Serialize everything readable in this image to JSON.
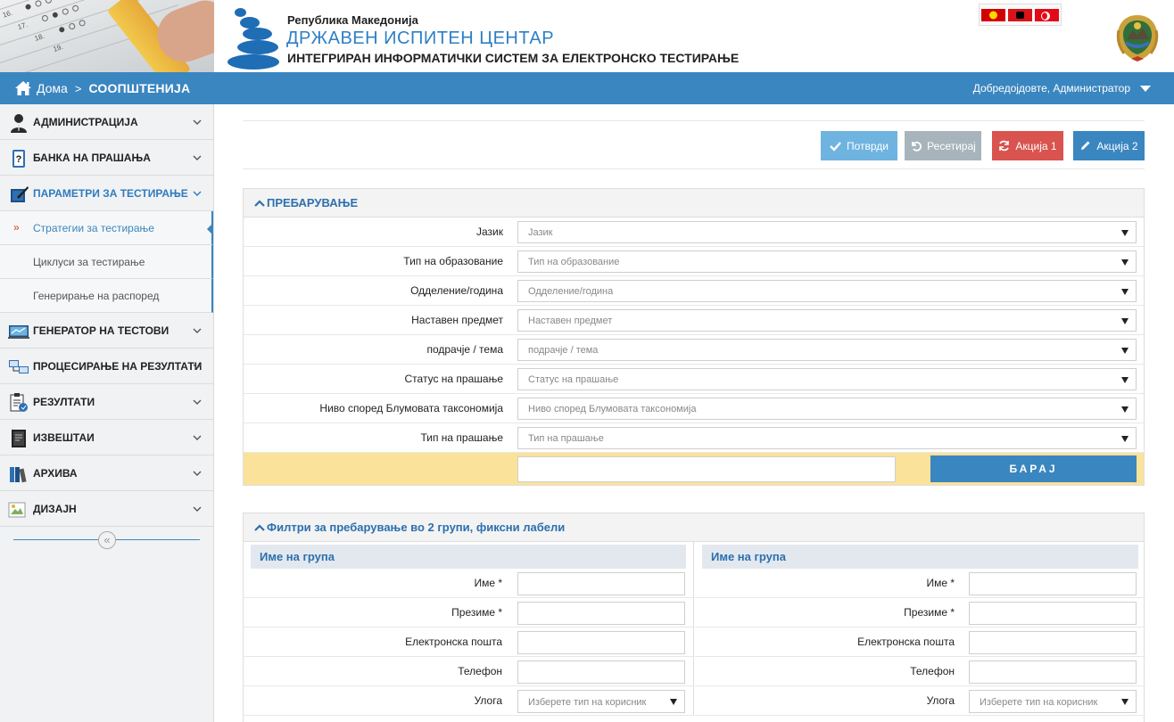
{
  "header": {
    "republic": "Република Македонија",
    "org_name": "ДРЖАВЕН ИСПИТЕН ЦЕНТАР",
    "system_name": "ИНТЕГРИРАН ИНФОРМАТИЧКИ СИСТЕМ ЗА ЕЛЕКТРОНСКО ТЕСТИРАЊЕ",
    "photo_sheet_text": [
      "16.",
      "17.",
      "18.",
      "19."
    ],
    "languages": [
      "mk",
      "sq",
      "tr"
    ]
  },
  "topbar": {
    "home_label": "Дома",
    "current_page": "СООПШТЕНИЈА",
    "welcome": "Добредојдовте, Администратор"
  },
  "sidebar": {
    "items": [
      {
        "label": "АДМИНИСТРАЦИЈА",
        "icon": "user-admin-icon"
      },
      {
        "label": "БАНКА НА ПРАШАЊА",
        "icon": "question-bank-icon"
      },
      {
        "label": "ПАРАМЕТРИ ЗА ТЕСТИРАЊЕ",
        "icon": "test-parameters-icon",
        "active": true
      },
      {
        "label": "ГЕНЕРАТОР НА ТЕСТОВИ",
        "icon": "test-generator-icon"
      },
      {
        "label": "ПРОЦЕСИРАЊЕ НА РЕЗУЛТАТИ",
        "icon": "result-processing-icon"
      },
      {
        "label": "РЕЗУЛТАТИ",
        "icon": "results-icon"
      },
      {
        "label": "ИЗВЕШТАИ",
        "icon": "reports-icon"
      },
      {
        "label": "АРХИВА",
        "icon": "archive-icon"
      },
      {
        "label": "ДИЗАЈН",
        "icon": "design-icon"
      }
    ],
    "subitems": [
      {
        "label": "Стратегии за тестирање",
        "current": true
      },
      {
        "label": "Циклуси за тестирање"
      },
      {
        "label": "Генерирање на распоред"
      }
    ],
    "collapse_glyph": "«"
  },
  "toolbar": {
    "confirm": "Потврди",
    "reset": "Ресетирај",
    "action1": "Акција 1",
    "action2": "Акција 2"
  },
  "search_panel": {
    "title": "ПРЕБАРУВАЊЕ",
    "fields": [
      {
        "label": "Јазик",
        "placeholder": "Јазик"
      },
      {
        "label": "Тип на образование",
        "placeholder": "Тип на образование"
      },
      {
        "label": "Одделение/година",
        "placeholder": "Одделение/година"
      },
      {
        "label": "Наставен предмет",
        "placeholder": "Наставен предмет"
      },
      {
        "label": "подрачје / тема",
        "placeholder": "подрачје / тема"
      },
      {
        "label": "Статус на прашање",
        "placeholder": "Статус на прашање"
      },
      {
        "label": "Ниво според Блумовата таксономија",
        "placeholder": "Ниво според Блумовата таксономија"
      },
      {
        "label": "Тип на прашање",
        "placeholder": "Тип на прашање"
      }
    ],
    "search_button": "БАРАЈ",
    "search_value": ""
  },
  "group_panel": {
    "title": "Филтри за пребарување во 2 групи, фиксни лабели",
    "groups": [
      {
        "title": "Име на група",
        "fields": [
          {
            "label": "Име *",
            "value": ""
          },
          {
            "label": "Презиме *",
            "value": ""
          },
          {
            "label": "Електронска пошта",
            "value": ""
          },
          {
            "label": "Телефон",
            "value": ""
          },
          {
            "label": "Улога",
            "placeholder": "Изберете тип на корисник"
          }
        ]
      },
      {
        "title": "Име на група",
        "fields": [
          {
            "label": "Име *",
            "value": ""
          },
          {
            "label": "Презиме *",
            "value": ""
          },
          {
            "label": "Електронска пошта",
            "value": ""
          },
          {
            "label": "Телефон",
            "value": ""
          },
          {
            "label": "Улога",
            "placeholder": "Изберете тип на корисник"
          }
        ]
      }
    ]
  },
  "colors": {
    "brand_blue": "#3a86c0",
    "accent_red": "#d9534f",
    "search_bar_yellow": "#fbe29a"
  }
}
